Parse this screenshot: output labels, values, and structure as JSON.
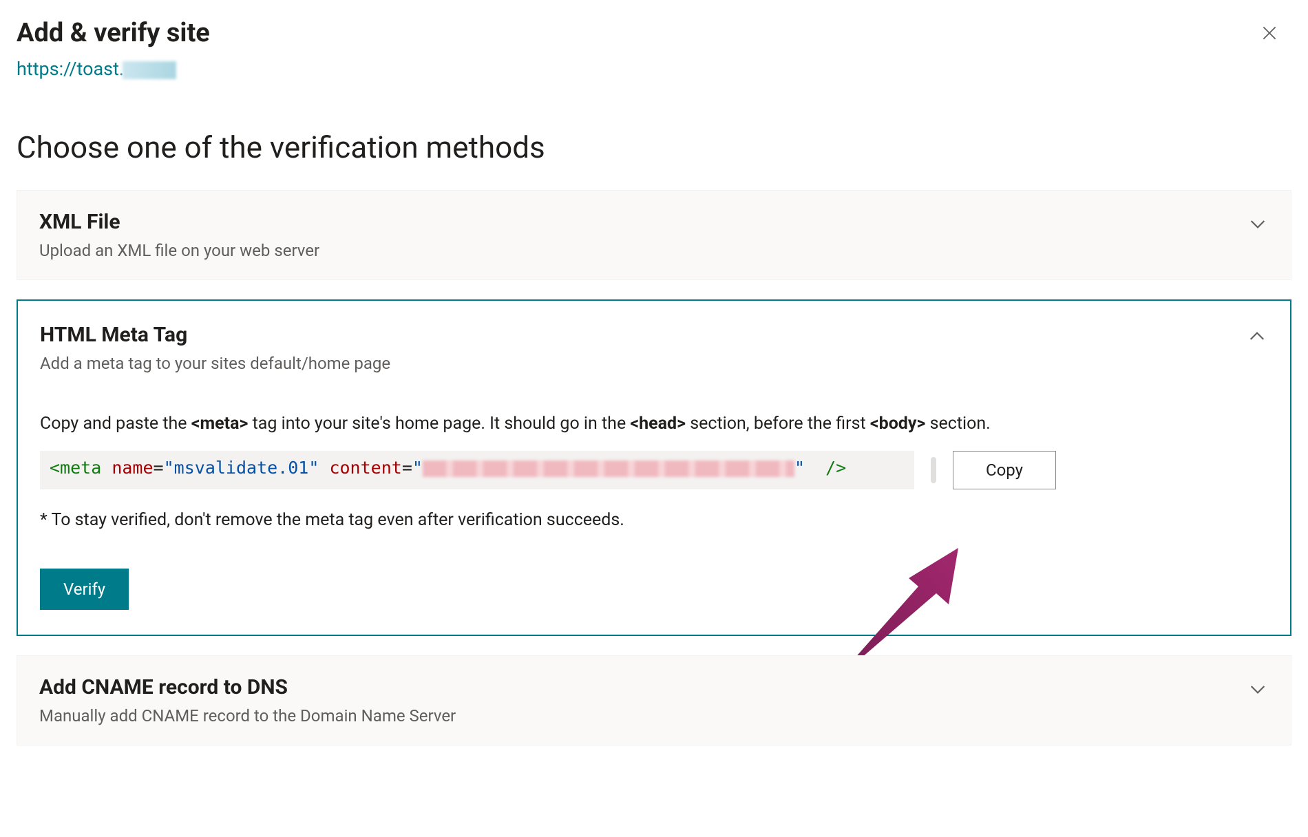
{
  "header": {
    "title": "Add & verify site",
    "site_url_prefix": "https://toast."
  },
  "section_heading": "Choose one of the verification methods",
  "panels": {
    "xml": {
      "title": "XML File",
      "subtitle": "Upload an XML file on your web server"
    },
    "meta": {
      "title": "HTML Meta Tag",
      "subtitle": "Add a meta tag to your sites default/home page",
      "instruction_pre": "Copy and paste the ",
      "instruction_tag1": "<meta>",
      "instruction_mid1": " tag into your site's home page. It should go in the ",
      "instruction_tag2": "<head>",
      "instruction_mid2": " section, before the first ",
      "instruction_tag3": "<body>",
      "instruction_post": " section.",
      "code": {
        "open": "<meta",
        "attr_name": "name",
        "val_name": "\"msvalidate.01\"",
        "attr_content": "content",
        "val_content_open": "\"",
        "val_content_close": "\"",
        "close": "/>"
      },
      "copy_label": "Copy",
      "note": "* To stay verified, don't remove the meta tag even after verification succeeds.",
      "verify_label": "Verify"
    },
    "cname": {
      "title": "Add CNAME record to DNS",
      "subtitle": "Manually add CNAME record to the Domain Name Server"
    }
  }
}
